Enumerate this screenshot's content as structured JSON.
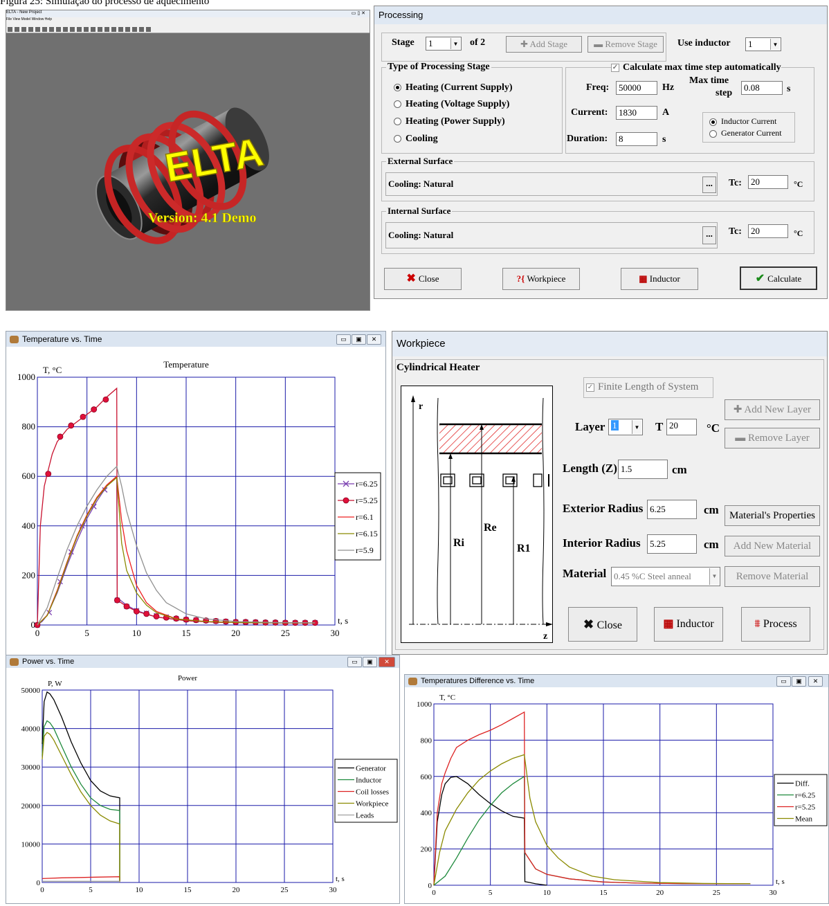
{
  "caption": "Figura 25: Simulação do processo de aquecimento",
  "main_window": {
    "title": "ELTA - New Project",
    "menu": "File View Model Window Help",
    "logo": "ELTA",
    "version": "Version: 4.1 Demo"
  },
  "processing": {
    "title": "Processing",
    "stage_label": "Stage",
    "stage_value": "1",
    "of_label": "of 2",
    "add_stage": "Add Stage",
    "remove_stage": "Remove Stage",
    "use_inductor_label": "Use inductor",
    "use_inductor_value": "1",
    "type_group": "Type of Processing Stage",
    "types": [
      "Heating (Current Supply)",
      "Heating (Voltage Supply)",
      "Heating (Power Supply)",
      "Cooling"
    ],
    "calc_max": "Calculate max time step automatically",
    "freq_label": "Freq:",
    "freq_value": "50000",
    "freq_unit": "Hz",
    "max_time_label1": "Max time",
    "max_time_label2": "step",
    "max_time_value": "0.08",
    "max_time_unit": "s",
    "current_label": "Current:",
    "current_value": "1830",
    "current_unit": "A",
    "duration_label": "Duration:",
    "duration_value": "8",
    "duration_unit": "s",
    "inductor_current": "Inductor Current",
    "generator_current": "Generator Current",
    "external_group": "External Surface",
    "external_cooling": "Cooling: Natural",
    "internal_group": "Internal Surface",
    "internal_cooling": "Cooling: Natural",
    "tc_label": "Tc:",
    "tc_ext": "20",
    "tc_int": "20",
    "tc_unit": "°C",
    "browse": "...",
    "close": "Close",
    "workpiece": "Workpiece",
    "inductor": "Inductor",
    "calculate": "Calculate"
  },
  "workpiece": {
    "title": "Workpiece",
    "heater": "Cylindrical Heater",
    "finite": "Finite Length of System",
    "add_layer": "Add New Layer",
    "remove_layer": "Remove Layer",
    "layer_label": "Layer",
    "layer_value": "1",
    "t_label": "T",
    "t_value": "20",
    "t_unit": "°C",
    "length_label": "Length (Z)",
    "length_value": "1.5",
    "length_unit": "cm",
    "ext_label": "Exterior Radius",
    "ext_value": "6.25",
    "ext_unit": "cm",
    "int_label": "Interior Radius",
    "int_value": "5.25",
    "int_unit": "cm",
    "material_label": "Material",
    "material_value": "0.45 %C Steel anneal",
    "mat_props": "Material's Properties",
    "add_material": "Add New Material",
    "remove_material": "Remove Material",
    "close": "Close",
    "inductor": "Inductor",
    "process": "Process",
    "diagram": {
      "r": "r",
      "z": "z",
      "ri": "Ri",
      "re": "Re",
      "r1": "R1"
    }
  },
  "colors": {
    "grid": "#1a1aa8",
    "bg": "#ffffff",
    "legend_border": "#000000"
  },
  "chart_data": [
    {
      "window_title": "Temperature vs. Time",
      "type": "line",
      "title": "Temperature",
      "xlabel": "t, s",
      "ylabel": "T, °C",
      "xlim": [
        0,
        30
      ],
      "ylim": [
        0,
        1000
      ],
      "xticks": [
        0,
        5,
        10,
        15,
        20,
        25,
        30
      ],
      "yticks": [
        0,
        200,
        400,
        600,
        800,
        1000
      ],
      "grid": true,
      "legend_position": "right",
      "series": [
        {
          "name": "r=6.25",
          "color": "#7a3fb0",
          "marker": "x",
          "x": [
            0,
            0.5,
            1,
            2,
            3,
            4,
            5,
            6,
            7,
            8,
            8.05,
            9,
            10,
            12,
            15,
            18,
            21,
            24,
            28
          ],
          "y": [
            0,
            15,
            40,
            130,
            240,
            340,
            430,
            500,
            560,
            600,
            110,
            80,
            58,
            32,
            18,
            12,
            9,
            8,
            8
          ],
          "marker_x": [
            0,
            1.2,
            2.3,
            3.4,
            4.5,
            5.7,
            6.8,
            8.05,
            9,
            10,
            11,
            12,
            13,
            14,
            15,
            16,
            17,
            18,
            19,
            20,
            21,
            22,
            23,
            24,
            25,
            26,
            27,
            28
          ],
          "marker_y": [
            0,
            50,
            175,
            295,
            400,
            478,
            545,
            100,
            75,
            58,
            48,
            38,
            32,
            26,
            22,
            20,
            18,
            16,
            14,
            12,
            12,
            11,
            10,
            10,
            9,
            9,
            9,
            9
          ]
        },
        {
          "name": "r=5.25",
          "color": "#c8102e",
          "marker": "circle",
          "x": [
            0,
            0.3,
            0.7,
            1,
            1.5,
            2,
            3,
            4,
            5,
            6,
            7,
            8,
            8.05,
            9,
            10,
            12,
            15,
            18,
            22,
            28
          ],
          "y": [
            0,
            400,
            560,
            610,
            690,
            740,
            790,
            820,
            850,
            880,
            920,
            955,
            100,
            75,
            55,
            32,
            17,
            11,
            9,
            8
          ],
          "marker_x": [
            0,
            1.1,
            2.3,
            3.4,
            4.6,
            5.7,
            6.9,
            8.05,
            9,
            10,
            11,
            12,
            13,
            14,
            15,
            16,
            17,
            18,
            19,
            20,
            21,
            22,
            23,
            24,
            25,
            26,
            27,
            28
          ],
          "marker_y": [
            0,
            610,
            760,
            805,
            840,
            870,
            910,
            100,
            75,
            55,
            45,
            35,
            30,
            26,
            22,
            20,
            18,
            16,
            14,
            12,
            12,
            11,
            10,
            10,
            9,
            9,
            9,
            9
          ]
        },
        {
          "name": "r=6.1",
          "color": "#ee2222",
          "x": [
            0,
            1,
            2,
            3,
            4,
            5,
            6,
            7,
            8,
            8.5,
            9,
            10,
            11,
            12,
            14,
            17,
            20,
            24,
            28
          ],
          "y": [
            0,
            40,
            140,
            255,
            360,
            445,
            515,
            565,
            600,
            420,
            300,
            160,
            90,
            55,
            25,
            14,
            10,
            9,
            8
          ]
        },
        {
          "name": "r=6.15",
          "color": "#8a8a00",
          "x": [
            0,
            1,
            2,
            3,
            4,
            5,
            6,
            7,
            8,
            8.5,
            9,
            10,
            11,
            12,
            14,
            17,
            20,
            24,
            28
          ],
          "y": [
            0,
            38,
            135,
            250,
            355,
            440,
            510,
            560,
            595,
            330,
            220,
            130,
            80,
            50,
            24,
            14,
            10,
            9,
            8
          ]
        },
        {
          "name": "r=5.9",
          "color": "#909090",
          "x": [
            0,
            1,
            2,
            3,
            4,
            5,
            6,
            7,
            8,
            8.5,
            9,
            10,
            11,
            12,
            13,
            15,
            17,
            20,
            24,
            28
          ],
          "y": [
            0,
            70,
            190,
            305,
            400,
            480,
            545,
            600,
            640,
            560,
            460,
            320,
            210,
            140,
            90,
            45,
            25,
            14,
            10,
            9
          ]
        }
      ]
    },
    {
      "window_title": "Power vs. Time",
      "type": "line",
      "title": "Power",
      "xlabel": "t, s",
      "ylabel": "P, W",
      "xlim": [
        0,
        30
      ],
      "ylim": [
        0,
        50000
      ],
      "xticks": [
        0,
        5,
        10,
        15,
        20,
        25,
        30
      ],
      "yticks": [
        0,
        10000,
        20000,
        30000,
        40000,
        50000
      ],
      "grid": true,
      "legend_position": "right",
      "series": [
        {
          "name": "Generator",
          "color": "#000000",
          "x": [
            0,
            0.2,
            0.5,
            0.8,
            1.2,
            2,
            3,
            4,
            5,
            6,
            7,
            8,
            8
          ],
          "y": [
            36000,
            47000,
            49500,
            49000,
            47500,
            43000,
            36500,
            31000,
            26500,
            23800,
            22500,
            22000,
            0
          ]
        },
        {
          "name": "Inductor",
          "color": "#1e8a3c",
          "x": [
            0,
            0.2,
            0.5,
            0.8,
            1.2,
            2,
            3,
            4,
            5,
            6,
            7,
            8,
            8
          ],
          "y": [
            33000,
            40500,
            42000,
            41500,
            40000,
            35500,
            30000,
            25500,
            22000,
            20000,
            19000,
            18700,
            0
          ]
        },
        {
          "name": "Coil losses",
          "color": "#dd2222",
          "x": [
            0,
            2,
            4,
            6,
            8,
            8
          ],
          "y": [
            1000,
            1200,
            1300,
            1400,
            1500,
            0
          ]
        },
        {
          "name": "Workpiece",
          "color": "#8a8a00",
          "x": [
            0,
            0.2,
            0.5,
            0.8,
            1.2,
            2,
            3,
            4,
            5,
            6,
            7,
            8,
            8
          ],
          "y": [
            32000,
            38000,
            39000,
            38500,
            37000,
            33000,
            28000,
            23500,
            20000,
            17500,
            16000,
            15200,
            0
          ]
        },
        {
          "name": "Leads",
          "color": "#a0a0a0",
          "x": [
            0,
            8,
            8
          ],
          "y": [
            300,
            300,
            0
          ]
        }
      ]
    },
    {
      "window_title": "Temperatures Difference vs. Time",
      "type": "line",
      "title": "",
      "xlabel": "t, s",
      "ylabel": "T, °C",
      "xlim": [
        0,
        30
      ],
      "ylim": [
        0,
        1000
      ],
      "xticks": [
        0,
        5,
        10,
        15,
        20,
        25,
        30
      ],
      "yticks": [
        0,
        200,
        400,
        600,
        800,
        1000
      ],
      "grid": true,
      "legend_position": "right",
      "series": [
        {
          "name": "Diff.",
          "color": "#000000",
          "x": [
            0,
            0.3,
            0.7,
            1,
            1.5,
            2,
            3,
            4,
            5,
            6,
            7,
            8,
            8.05,
            8.5,
            9,
            10
          ],
          "y": [
            0,
            350,
            500,
            560,
            595,
            600,
            560,
            500,
            450,
            410,
            380,
            370,
            20,
            15,
            8,
            0
          ]
        },
        {
          "name": "r=6.25",
          "color": "#1e8a3c",
          "x": [
            0,
            1,
            2,
            3,
            4,
            5,
            6,
            7,
            8,
            8.05,
            9,
            10,
            12,
            15,
            18,
            22,
            28
          ],
          "y": [
            0,
            50,
            150,
            260,
            360,
            440,
            510,
            560,
            600,
            180,
            90,
            60,
            35,
            18,
            12,
            9,
            8
          ]
        },
        {
          "name": "r=5.25",
          "color": "#dd2222",
          "x": [
            0,
            0.3,
            0.7,
            1,
            1.5,
            2,
            3,
            4,
            5,
            6,
            7,
            8,
            8.05,
            9,
            10,
            12,
            15,
            18,
            22,
            28
          ],
          "y": [
            0,
            400,
            560,
            620,
            700,
            760,
            800,
            830,
            855,
            885,
            920,
            955,
            180,
            90,
            60,
            35,
            18,
            12,
            9,
            8
          ]
        },
        {
          "name": "Mean",
          "color": "#8a8a00",
          "x": [
            0,
            0.5,
            1,
            2,
            3,
            4,
            5,
            6,
            7,
            8,
            8.5,
            9,
            10,
            11,
            12,
            14,
            16,
            20,
            24,
            28
          ],
          "y": [
            0,
            180,
            300,
            420,
            510,
            580,
            630,
            670,
            700,
            720,
            480,
            350,
            220,
            150,
            100,
            50,
            30,
            15,
            10,
            8
          ]
        }
      ]
    }
  ]
}
